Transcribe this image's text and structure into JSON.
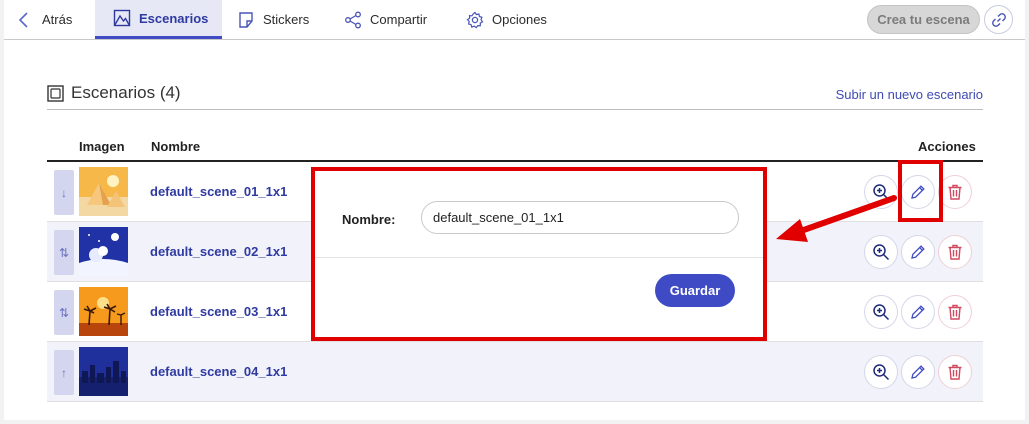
{
  "nav": {
    "back": "Atrás",
    "scenes": "Escenarios",
    "stickers": "Stickers",
    "share": "Compartir",
    "options": "Opciones",
    "create": "Crea tu escena"
  },
  "section": {
    "title": "Escenarios (4)",
    "upload": "Subir un nuevo escenario"
  },
  "table": {
    "headers": {
      "image": "Imagen",
      "name": "Nombre",
      "actions": "Acciones"
    },
    "rows": [
      {
        "name": "default_scene_01_1x1",
        "handle": "↓"
      },
      {
        "name": "default_scene_02_1x1",
        "handle": "⇅"
      },
      {
        "name": "default_scene_03_1x1",
        "handle": "⇅"
      },
      {
        "name": "default_scene_04_1x1",
        "handle": "↑"
      }
    ]
  },
  "popup": {
    "label": "Nombre:",
    "value": "default_scene_01_1x1",
    "save": "Guardar"
  },
  "colors": {
    "accent": "#3f4bc4",
    "link": "#2f3aa1",
    "highlight": "#e00000",
    "delete": "#d2485f"
  },
  "icons": [
    "chevron-left-icon",
    "scene-icon",
    "sticker-icon",
    "share-icon",
    "gear-icon",
    "link-icon",
    "frame-icon",
    "zoom-in-icon",
    "pencil-icon",
    "trash-icon",
    "arrow-icon"
  ]
}
